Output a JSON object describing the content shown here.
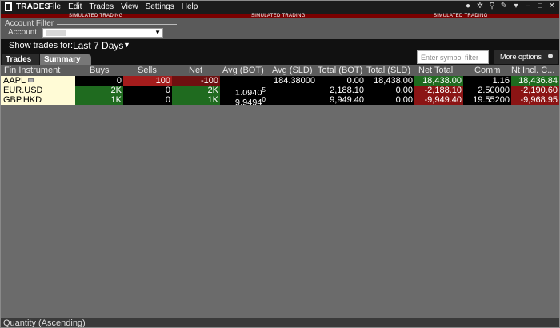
{
  "window": {
    "title": "TRADES",
    "menu": [
      "File",
      "Edit",
      "Trades",
      "View",
      "Settings",
      "Help"
    ]
  },
  "banner": {
    "text": "SIMULATED TRADING",
    "color": "#7a0000"
  },
  "filter": {
    "title": "Account Filter",
    "account_label": "Account:",
    "account_value": ""
  },
  "show_trades": {
    "label": "Show trades for:",
    "value": "Last 7 Days"
  },
  "tabs": [
    {
      "label": "Trades"
    },
    {
      "label": "Summary",
      "active": true
    }
  ],
  "search": {
    "placeholder": "Enter symbol filter"
  },
  "more_options": {
    "label": "More options"
  },
  "table": {
    "columns": [
      "Fin Instrument",
      "Buys",
      "Sells",
      "Net",
      "Avg (BOT)",
      "Avg (SLD)",
      "Total (BOT)",
      "Total (SLD)",
      "Net Total",
      "Comm",
      "Nt Incl. C..."
    ],
    "rows": [
      {
        "symbol": "AAPL",
        "buys": "0",
        "sells": "100",
        "net": "-100",
        "avg_bot": "",
        "avg_sld": "184.38000",
        "total_bot": "0.00",
        "total_sld": "18,438.00",
        "net_total": "18,438.00",
        "comm": "1.16",
        "nt_incl": "18,436.84"
      },
      {
        "symbol": "EUR.USD",
        "buys": "2K",
        "sells": "0",
        "net": "2K",
        "avg_bot": "1.0940",
        "avg_bot_sup": "5",
        "avg_sld": "",
        "total_bot": "2,188.10",
        "total_sld": "0.00",
        "net_total": "-2,188.10",
        "comm": "2.50000",
        "nt_incl": "-2,190.60"
      },
      {
        "symbol": "GBP.HKD",
        "buys": "1K",
        "sells": "0",
        "net": "1K",
        "avg_bot": "9.9494",
        "avg_bot_sup": "0",
        "avg_sld": "",
        "total_bot": "9,949.40",
        "total_sld": "0.00",
        "net_total": "-9,949.40",
        "comm": "19.55200",
        "nt_incl": "-9,968.95"
      }
    ]
  },
  "status": {
    "sort_label": "Quantity (Ascending)"
  },
  "colors": {
    "positive": "#1f6b1f",
    "negative": "#8b1414",
    "positive_bright": "#2e7d2e",
    "negative_bright": "#a41c1c",
    "symbol_bg": "#fffbd6"
  }
}
